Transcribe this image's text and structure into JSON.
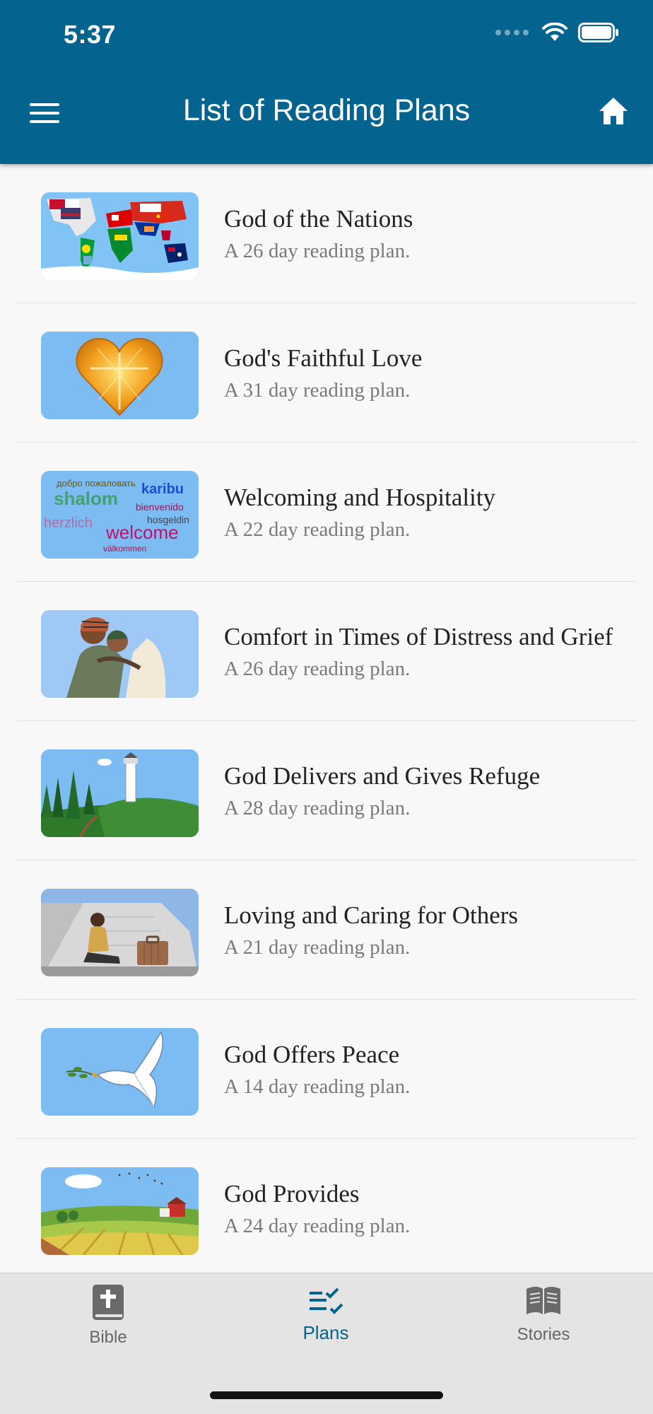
{
  "status_bar": {
    "time": "5:37"
  },
  "header": {
    "title": "List of Reading Plans"
  },
  "plans": [
    {
      "title": "God of the Nations",
      "subtitle": "A 26 day reading plan.",
      "image": "world-flags-map"
    },
    {
      "title": "God's Faithful Love",
      "subtitle": "A 31 day reading plan.",
      "image": "golden-heart"
    },
    {
      "title": "Welcoming and Hospitality",
      "subtitle": "A 22 day reading plan.",
      "image": "welcome-word-cloud"
    },
    {
      "title": "Comfort in Times of Distress and Grief",
      "subtitle": "A 26 day reading plan.",
      "image": "embracing-people"
    },
    {
      "title": "God Delivers and Gives Refuge",
      "subtitle": "A 28 day reading plan.",
      "image": "lighthouse-landscape"
    },
    {
      "title": "Loving and Caring for Others",
      "subtitle": "A 21 day reading plan.",
      "image": "sitting-person-suitcase"
    },
    {
      "title": "God Offers Peace",
      "subtitle": "A 14 day reading plan.",
      "image": "dove-olive-branch"
    },
    {
      "title": "God Provides",
      "subtitle": "A 24 day reading plan.",
      "image": "farm-fields"
    }
  ],
  "welcome_words": [
    "добро пожаловать",
    "karibu",
    "shalom",
    "bienvenido",
    "hosgeldin",
    "herzlich",
    "welcome",
    "välkommen"
  ],
  "tabs": [
    {
      "label": "Bible",
      "icon": "bible-icon"
    },
    {
      "label": "Plans",
      "icon": "plans-checklist-icon"
    },
    {
      "label": "Stories",
      "icon": "open-book-icon"
    }
  ],
  "colors": {
    "header": "#05638f",
    "accent": "#05638f",
    "thumb_sky": "#7dbbf3",
    "tabbar": "#e4e4e4"
  }
}
